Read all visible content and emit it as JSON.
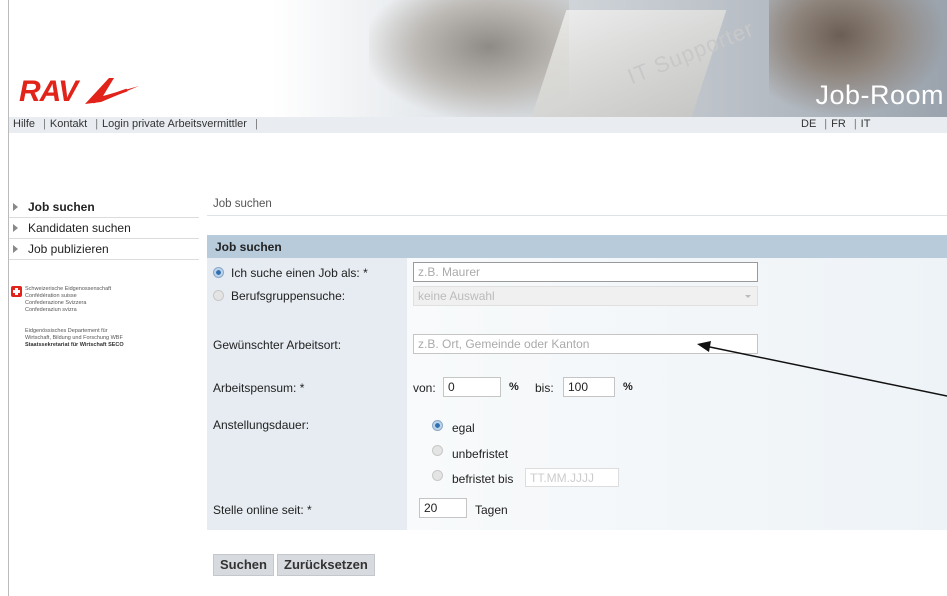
{
  "header": {
    "logo_text": "RAV",
    "title": "Job-Room"
  },
  "topnav": {
    "left": [
      "Hilfe",
      "Kontakt",
      "Login private Arbeitsvermittler"
    ],
    "languages": [
      "DE",
      "FR",
      "IT"
    ]
  },
  "sidebar": {
    "items": [
      {
        "label": "Job suchen",
        "active": true
      },
      {
        "label": "Kandidaten suchen",
        "active": false
      },
      {
        "label": "Job publizieren",
        "active": false
      }
    ],
    "seco": {
      "line1": "Schweizerische Eidgenossenschaft",
      "line2": "Confédération suisse",
      "line3": "Confederazione Svizzera",
      "line4": "Confederaziun svizra",
      "dept1": "Eidgenössisches Departement für",
      "dept2": "Wirtschaft, Bildung und Forschung WBF",
      "office": "Staatssekretariat für Wirtschaft SECO"
    }
  },
  "main": {
    "breadcrumb": "Job suchen",
    "panel_title": "Job suchen",
    "job_as": {
      "label": "Ich suche einen Job als: *",
      "placeholder": "z.B. Maurer",
      "selected": true
    },
    "group_search": {
      "label": "Berufsgruppensuche:",
      "value": "keine Auswahl",
      "selected": false
    },
    "location": {
      "label": "Gewünschter Arbeitsort:",
      "placeholder": "z.B. Ort, Gemeinde oder Kanton"
    },
    "workload": {
      "label": "Arbeitspensum: *",
      "from_label": "von:",
      "from_value": "0",
      "to_label": "bis:",
      "to_value": "100",
      "unit": "%"
    },
    "duration": {
      "label": "Anstellungsdauer:",
      "options": [
        {
          "label": "egal",
          "selected": true
        },
        {
          "label": "unbefristet",
          "selected": false
        },
        {
          "label": "befristet bis",
          "selected": false
        }
      ],
      "date_placeholder": "TT.MM.JJJJ"
    },
    "online_since": {
      "label": "Stelle online seit: *",
      "value": "20",
      "unit": "Tagen"
    },
    "buttons": {
      "search": "Suchen",
      "reset": "Zurücksetzen"
    }
  }
}
